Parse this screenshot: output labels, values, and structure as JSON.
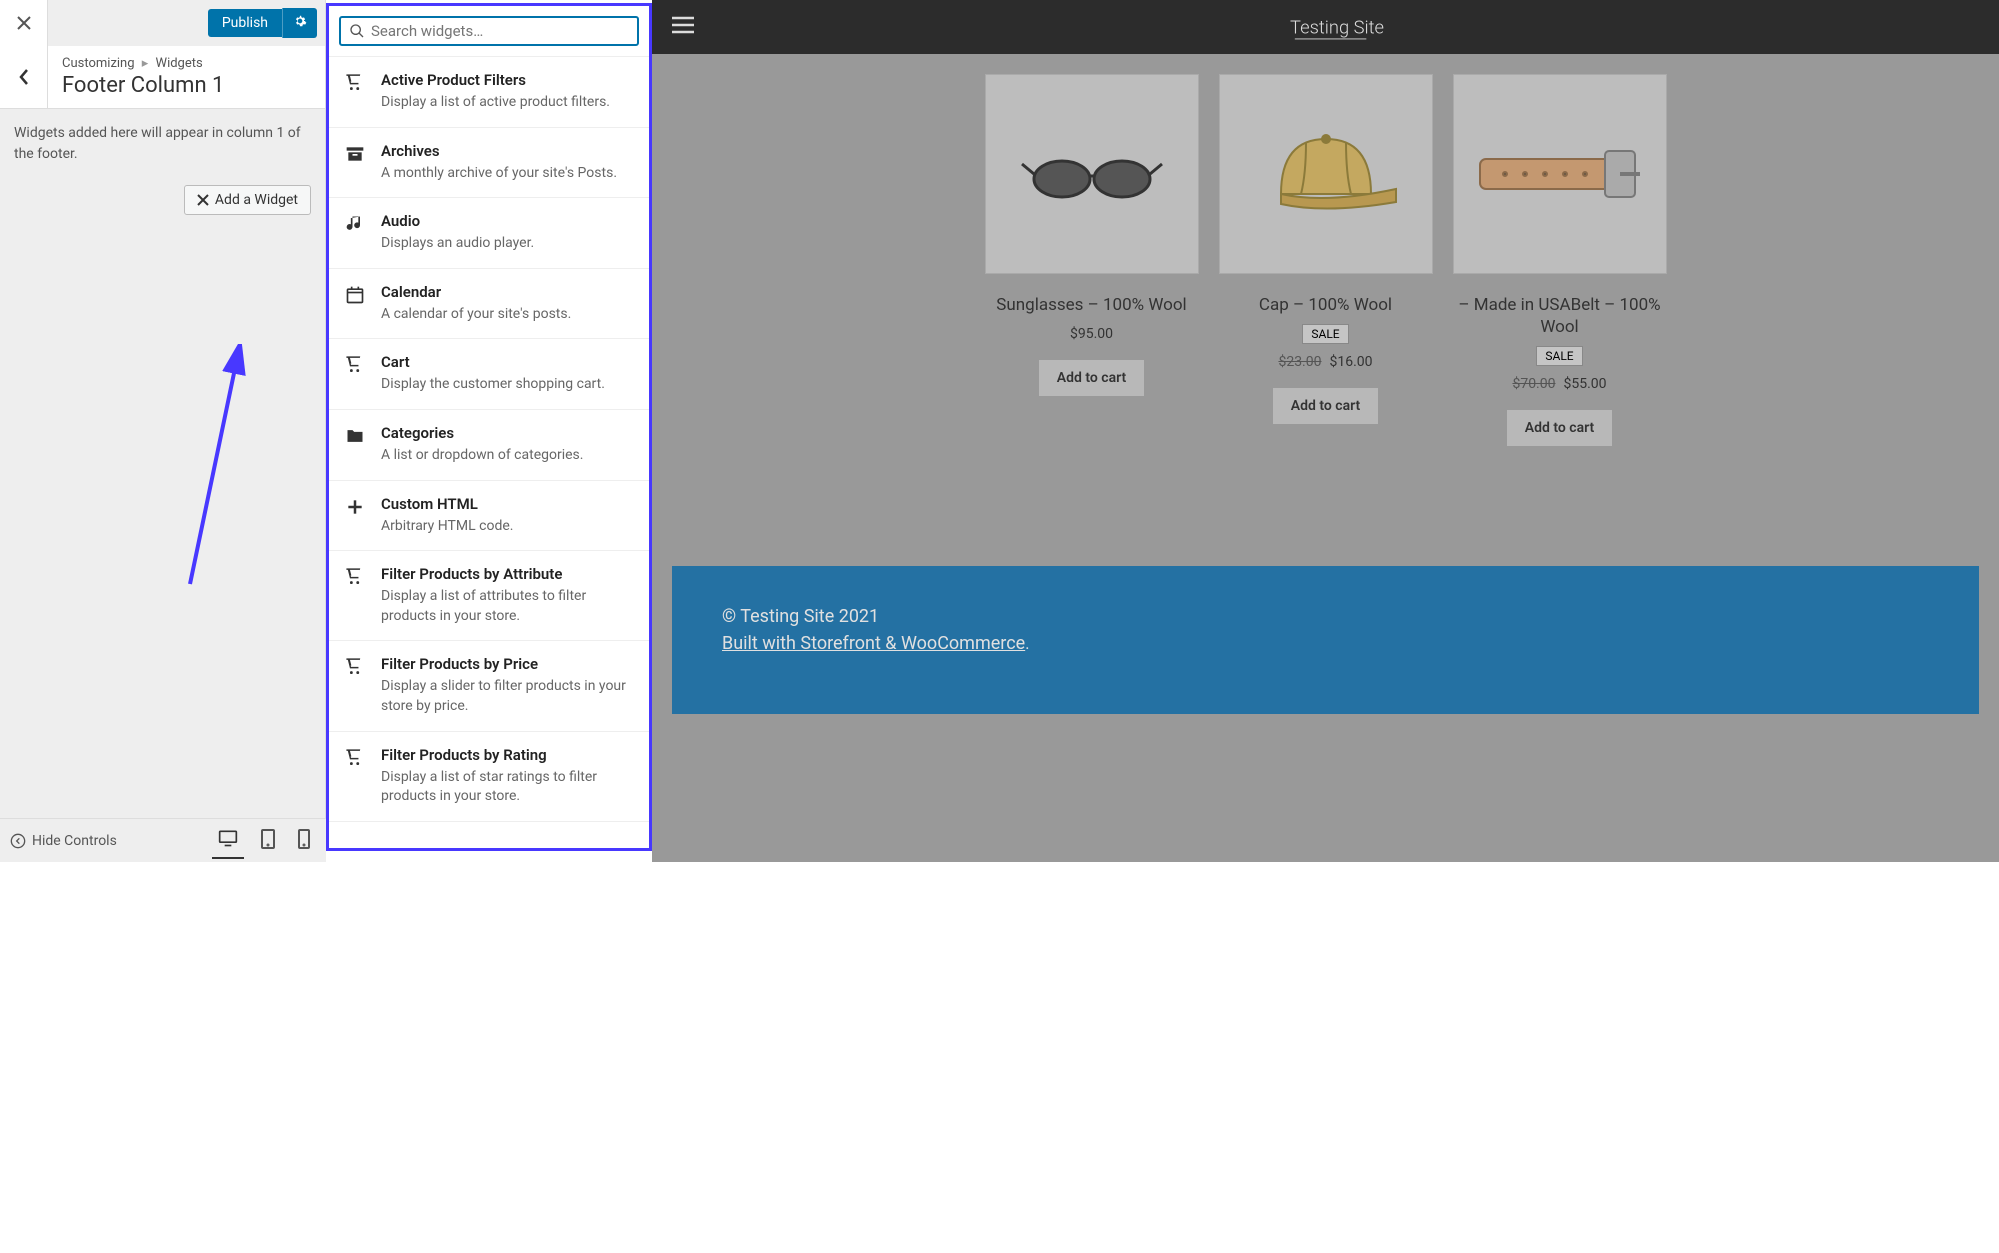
{
  "header": {
    "publish_label": "Publish"
  },
  "breadcrumb": {
    "parent": "Customizing",
    "child": "Widgets"
  },
  "section_title": "Footer Column 1",
  "section_desc": "Widgets added here will appear in column 1 of the footer.",
  "add_widget_label": "Add a Widget",
  "search_placeholder": "Search widgets…",
  "widgets": [
    {
      "icon": "cart-icon",
      "name": "Active Product Filters",
      "desc": "Display a list of active product filters."
    },
    {
      "icon": "archive-icon",
      "name": "Archives",
      "desc": "A monthly archive of your site's Posts."
    },
    {
      "icon": "audio-icon",
      "name": "Audio",
      "desc": "Displays an audio player."
    },
    {
      "icon": "calendar-icon",
      "name": "Calendar",
      "desc": "A calendar of your site's posts."
    },
    {
      "icon": "cart-icon",
      "name": "Cart",
      "desc": "Display the customer shopping cart."
    },
    {
      "icon": "folder-icon",
      "name": "Categories",
      "desc": "A list or dropdown of categories."
    },
    {
      "icon": "plus-icon",
      "name": "Custom HTML",
      "desc": "Arbitrary HTML code."
    },
    {
      "icon": "cart-icon",
      "name": "Filter Products by Attribute",
      "desc": "Display a list of attributes to filter products in your store."
    },
    {
      "icon": "cart-icon",
      "name": "Filter Products by Price",
      "desc": "Display a slider to filter products in your store by price."
    },
    {
      "icon": "cart-icon",
      "name": "Filter Products by Rating",
      "desc": "Display a list of star ratings to filter products in your store."
    }
  ],
  "site_title": "Testing Site",
  "products": [
    {
      "title": "Sunglasses – 100% Wool",
      "price": "$95.00",
      "old_price": null,
      "sale": false,
      "add_label": "Add to cart",
      "img": "sunglasses"
    },
    {
      "title": "Cap – 100% Wool",
      "price": "$16.00",
      "old_price": "$23.00",
      "sale": true,
      "add_label": "Add to cart",
      "img": "cap"
    },
    {
      "title": "– Made in USABelt – 100% Wool",
      "price": "$55.00",
      "old_price": "$70.00",
      "sale": true,
      "add_label": "Add to cart",
      "img": "belt"
    }
  ],
  "sale_label": "SALE",
  "footer": {
    "copyright": "© Testing Site 2021",
    "built": "Built with Storefront & WooCommerce",
    "period": "."
  },
  "bottom_bar": {
    "hide_label": "Hide Controls"
  }
}
